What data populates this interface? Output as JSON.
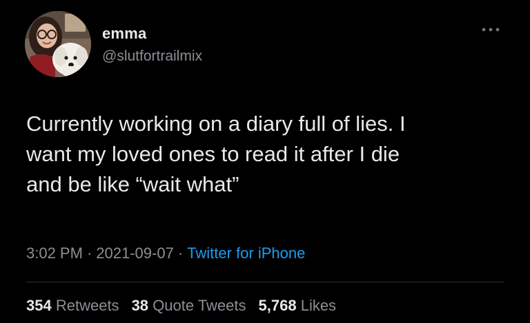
{
  "tweet": {
    "author": {
      "name": "emma",
      "handle": "@slutfortrailmix"
    },
    "text": "Currently working on a diary full of lies. I\nwant my loved ones to read it after I die\nand be like “wait what”",
    "time": "3:02 PM",
    "date": "2021-09-07",
    "separator": "·",
    "source": "Twitter for iPhone",
    "stats": {
      "retweets_count": "354",
      "retweets_label": "Retweets",
      "quotes_count": "38",
      "quotes_label": "Quote Tweets",
      "likes_count": "5,768",
      "likes_label": "Likes"
    }
  },
  "icons": {
    "more": "more-horizontal-icon"
  },
  "colors": {
    "background": "#000000",
    "text": "#e7e9ea",
    "secondary": "#8b9096",
    "link": "#1d9bf0"
  }
}
